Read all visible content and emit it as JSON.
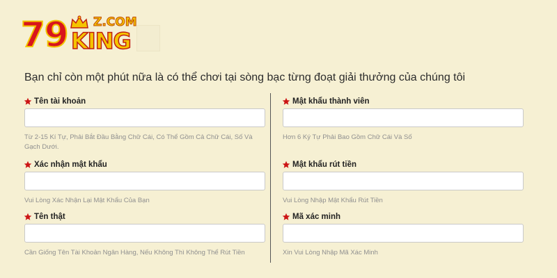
{
  "logo": {
    "number": "79",
    "brand": "KING",
    "domain": "Z.COM",
    "crown_icon": "crown-icon",
    "colors": {
      "red": "#d8151c",
      "gold": "#f2c200"
    }
  },
  "headline": "Bạn chỉ còn một phút nữa là có thể chơi tại sòng bạc từng đoạt giải thưởng của chúng tôi",
  "form": {
    "required_icon": "star-icon",
    "required_color": "#cc1515",
    "left": [
      {
        "label": "Tên tài khoản",
        "value": "",
        "hint": "Từ 2-15 Kí Tự, Phải Bắt Đầu Bằng Chữ Cái, Có Thể Gồm Cả Chữ Cái, Số Và Gạch Dưới."
      },
      {
        "label": "Xác nhận mật khẩu",
        "value": "",
        "hint": "Vui Lòng Xác Nhận Lại Mật Khẩu Của Bạn"
      },
      {
        "label": "Tên thật",
        "value": "",
        "hint": "Cần Giống Tên Tài Khoản Ngân Hàng, Nếu Không Thì Không Thể Rút Tiền"
      }
    ],
    "right": [
      {
        "label": "Mật khẩu thành viên",
        "value": "",
        "hint": "Hơn 6 Ký Tự Phải Bao Gồm Chữ Cái Và Số"
      },
      {
        "label": "Mật khẩu rút tiền",
        "value": "",
        "hint": "Vui Lòng Nhập Mật Khẩu Rút Tiền"
      },
      {
        "label": "Mã xác minh",
        "value": "",
        "hint": "Xin Vui Lòng Nhập Mã Xác Minh"
      }
    ]
  }
}
